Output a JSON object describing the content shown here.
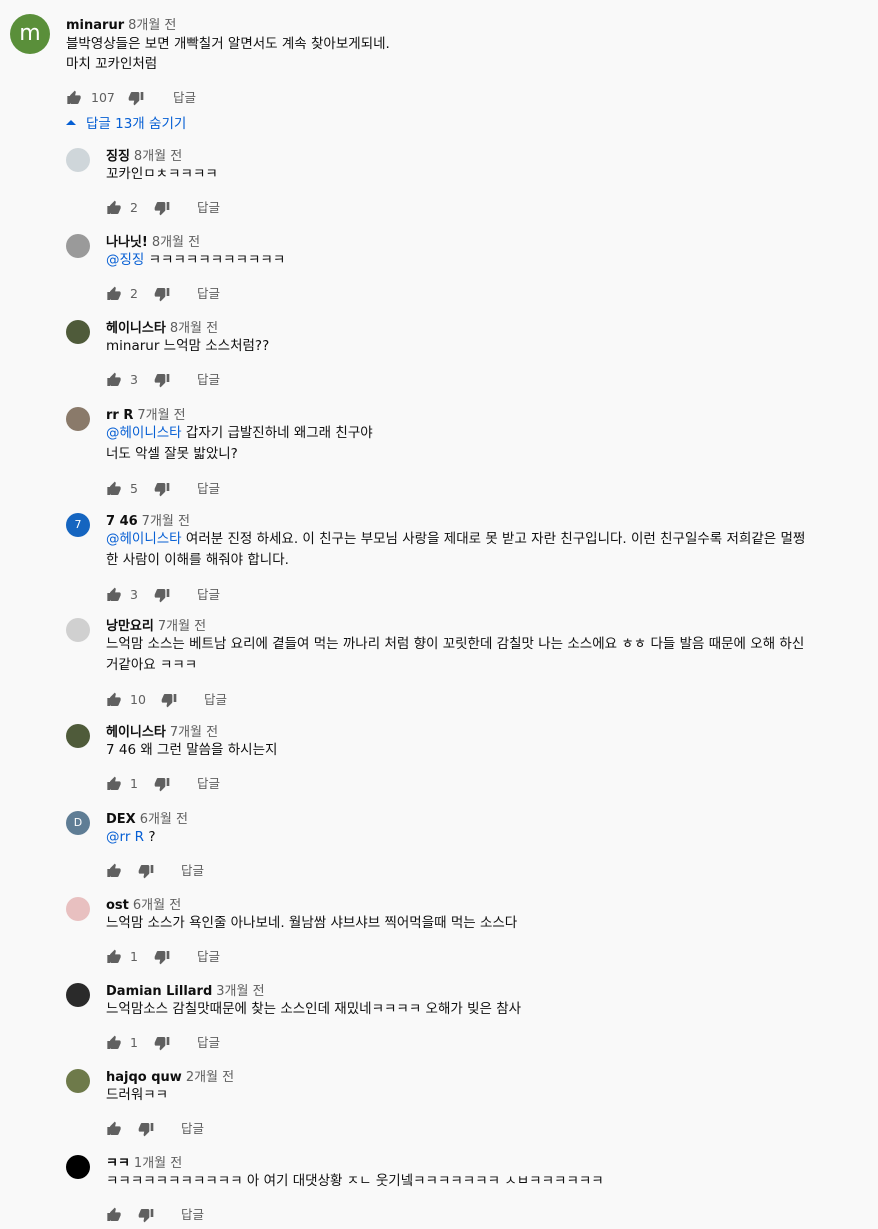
{
  "main_comment": {
    "avatar_letter": "m",
    "author": "minarur",
    "time": "8개월 전",
    "lines": [
      "블박영상들은 보면 개빡칠거 알면서도 계속 찾아보게되네.",
      "마치 꼬카인처럼"
    ],
    "likes": "107",
    "reply_label": "답글"
  },
  "replies_toggle": {
    "label": "답글 13개 숨기기"
  },
  "replies": [
    {
      "author": "징징",
      "time": "8개월 전",
      "mention": "",
      "text": "꼬카인ㅁㅊㅋㅋㅋㅋ",
      "text2": "",
      "likes": "2",
      "reply_label": "답글"
    },
    {
      "author": "나나닛!",
      "time": "8개월 전",
      "mention": "@징징",
      "text": " ㅋㅋㅋㅋㅋㅋㅋㅋㅋㅋㅋ",
      "text2": "",
      "likes": "2",
      "reply_label": "답글"
    },
    {
      "author": "헤이니스타",
      "time": "8개월 전",
      "mention": "",
      "text": "minarur 느억맘 소스처럼??",
      "text2": "",
      "likes": "3",
      "reply_label": "답글"
    },
    {
      "author": "rr R",
      "time": "7개월 전",
      "mention": "@헤이니스타",
      "text": " 갑자기 급발진하네 왜그래 친구야",
      "text2": "너도 악셀 잘못 밟았니?",
      "likes": "5",
      "reply_label": "답글"
    },
    {
      "author": "7 46",
      "time": "7개월 전",
      "avatar_letter": "7",
      "mention": "@헤이니스타",
      "text": " 여러분 진정 하세요. 이 친구는 부모님 사랑을 제대로 못 받고 자란 친구입니다. 이런 친구일수록 저희같은 멀쩡",
      "text2": "한 사람이 이해를 해줘야 합니다.",
      "likes": "3",
      "reply_label": "답글"
    },
    {
      "author": "낭만요리",
      "time": "7개월 전",
      "mention": "",
      "text": "느억맘 소스는 베트남 요리에 곁들여 먹는 까나리 처럼 향이 꼬릿한데 감칠맛 나는 소스에요 ㅎㅎ 다들 발음 때문에 오해 하신",
      "text2": "거같아요 ㅋㅋㅋ",
      "likes": "10",
      "reply_label": "답글"
    },
    {
      "author": "헤이니스타",
      "time": "7개월 전",
      "mention": "",
      "text": "7 46 왜 그런 말씀을 하시는지",
      "text2": "",
      "likes": "1",
      "reply_label": "답글"
    },
    {
      "author": "DEX",
      "time": "6개월 전",
      "avatar_letter": "D",
      "mention": "@rr R",
      "text": " ?",
      "text2": "",
      "likes": "",
      "reply_label": "답글"
    },
    {
      "author": "ost",
      "time": "6개월 전",
      "mention": "",
      "text": "느억맘 소스가 욕인줄 아나보네. 월남쌈  샤브샤브  찍어먹을때 먹는 소스다",
      "text2": "",
      "likes": "1",
      "reply_label": "답글"
    },
    {
      "author": "Damian Lillard",
      "time": "3개월 전",
      "mention": "",
      "text": "느억맘소스 감칠맛때문에 찾는 소스인데 재밌네ㅋㅋㅋㅋ 오해가 빚은 참사",
      "text2": "",
      "likes": "1",
      "reply_label": "답글"
    },
    {
      "author": "hajqo quw",
      "time": "2개월 전",
      "mention": "",
      "text": "드러워ㅋㅋ",
      "text2": "",
      "likes": "",
      "reply_label": "답글"
    },
    {
      "author": "ㅋㅋ",
      "time": "1개월 전",
      "mention": "",
      "text": "ㅋㅋㅋㅋㅋㅋㅋㅋㅋㅋㅋ 아 여기 대댓상황 ㅈㄴ 웃기넼ㅋㅋㅋㅋㅋㅋㅋ ㅅㅂㅋㅋㅋㅋㅋㅋ",
      "text2": "",
      "likes": "",
      "reply_label": "답글"
    }
  ],
  "colors": {
    "link": "#065fd4",
    "secondary_text": "#606060",
    "avatar_m": "#5a8f3a",
    "avatar_7": "#1565c0",
    "avatar_D": "#5f7d95"
  }
}
